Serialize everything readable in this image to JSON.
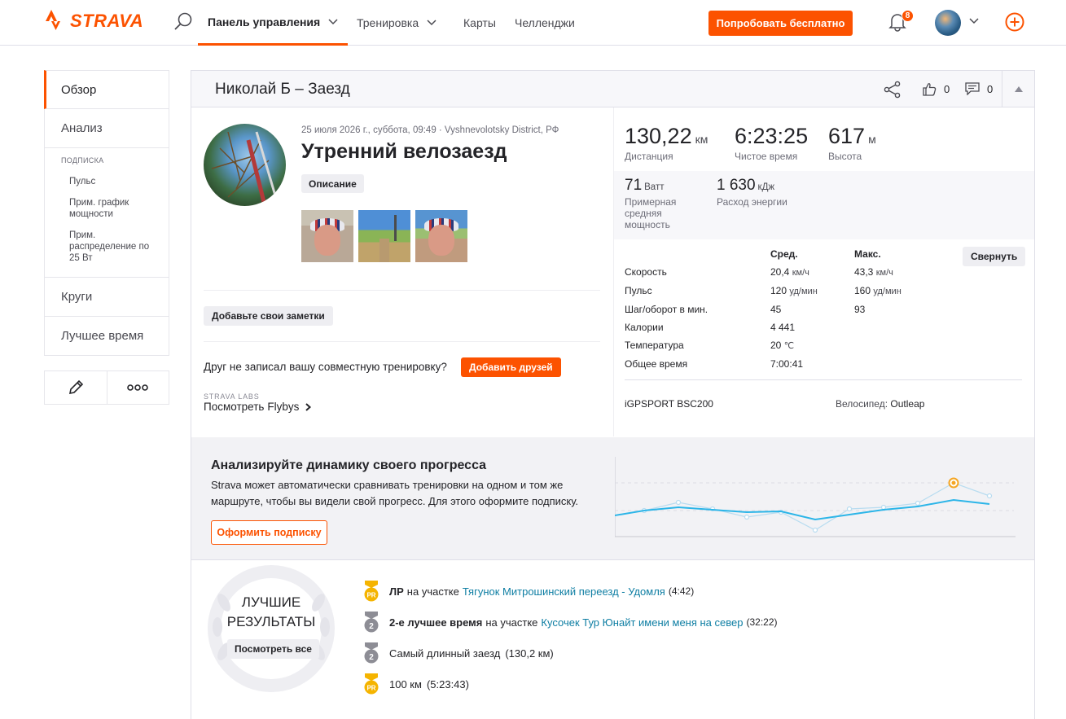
{
  "nav": {
    "logo": "STRAVA",
    "items": [
      {
        "label": "Панель управления"
      },
      {
        "label": "Тренировка"
      },
      {
        "label": "Карты"
      },
      {
        "label": "Челленджи"
      }
    ],
    "try_free": "Попробовать бесплатно",
    "notifications_count": "8"
  },
  "sidebar": {
    "items": [
      "Обзор",
      "Анализ"
    ],
    "subscription_title": "ПОДПИСКА",
    "sub_items": [
      "Пульс",
      "Прим. график мощности",
      "Прим. распределение по 25 Вт"
    ],
    "items2": [
      "Круги",
      "Лучшее время"
    ]
  },
  "activity": {
    "header_title": "Николай Б – Заезд",
    "kudos_count": "0",
    "comments_count": "0",
    "meta": "25 июля 2026 г., суббота, 09:49 · Vyshnevolotsky District, РФ",
    "name": "Утренний велозаезд",
    "description_tag": "Описание",
    "add_notes": "Добавьте свои заметки",
    "friend_question": "Друг не записал вашу совместную тренировку?",
    "add_friends": "Добавить друзей",
    "labs": "STRAVA LABS",
    "flybys_prefix": "Посмотреть",
    "flybys_name": "Flybys"
  },
  "stats": {
    "distance": {
      "value": "130,22",
      "unit": "км",
      "label": "Дистанция"
    },
    "moving_time": {
      "value": "6:23:25",
      "label": "Чистое время"
    },
    "elevation": {
      "value": "617",
      "unit": "м",
      "label": "Высота"
    },
    "power": {
      "value": "71",
      "unit": "Ватт",
      "label": "Примерная средняя мощность"
    },
    "energy": {
      "value": "1 630",
      "unit": "кДж",
      "label": "Расход энергии"
    }
  },
  "table": {
    "head_avg": "Сред.",
    "head_max": "Макс.",
    "collapse": "Свернуть",
    "rows": [
      {
        "label": "Скорость",
        "avg": "20,4",
        "avg_unit": "км/ч",
        "max": "43,3",
        "max_unit": "км/ч"
      },
      {
        "label": "Пульс",
        "avg": "120",
        "avg_unit": "уд/мин",
        "max": "160",
        "max_unit": "уд/мин"
      },
      {
        "label": "Шаг/оборот в мин.",
        "avg": "45",
        "avg_unit": "",
        "max": "93",
        "max_unit": ""
      },
      {
        "label": "Калории",
        "avg": "4 441",
        "avg_unit": "",
        "max": "",
        "max_unit": ""
      },
      {
        "label": "Температура",
        "avg": "20",
        "avg_unit": "℃",
        "max": "",
        "max_unit": ""
      },
      {
        "label": "Общее время",
        "avg": "7:00:41",
        "avg_unit": "",
        "max": "",
        "max_unit": ""
      }
    ],
    "device": "iGPSPORT BSC200",
    "bike_label": "Велосипед:",
    "bike_name": "Outleap"
  },
  "promo": {
    "title": "Анализируйте динамику своего прогресса",
    "text_brand": "Strava",
    "text": " может автоматически сравнивать тренировки на одном и том же маршруте, чтобы вы видели свой прогресс. Для этого оформите подписку.",
    "button": "Оформить подписку"
  },
  "best": {
    "title": "ЛУЧШИЕ РЕЗУЛЬТАТЫ",
    "button": "Посмотреть все",
    "achievements": [
      {
        "medal": "PR",
        "bold": "ЛР",
        "mid": "на участке",
        "segment": "Тягунок Митрошинский переезд - Удомля",
        "time": "(4:42)"
      },
      {
        "medal": "2",
        "bold": "2-е лучшее время",
        "mid": "на участке",
        "segment": "Кусочек Тур Юнайт имени меня на север",
        "time": "(32:22)"
      },
      {
        "medal": "2",
        "bold": "",
        "mid": "Самый длинный заезд",
        "segment": "",
        "time": "(130,2 км)"
      },
      {
        "medal": "PR",
        "bold": "",
        "mid": "100 км",
        "segment": "",
        "time": "(5:23:43)"
      }
    ]
  },
  "colors": {
    "brand": "#fc5200",
    "link": "#0e7ea3",
    "gold": "#f5b400",
    "silver": "#8d8d95"
  }
}
